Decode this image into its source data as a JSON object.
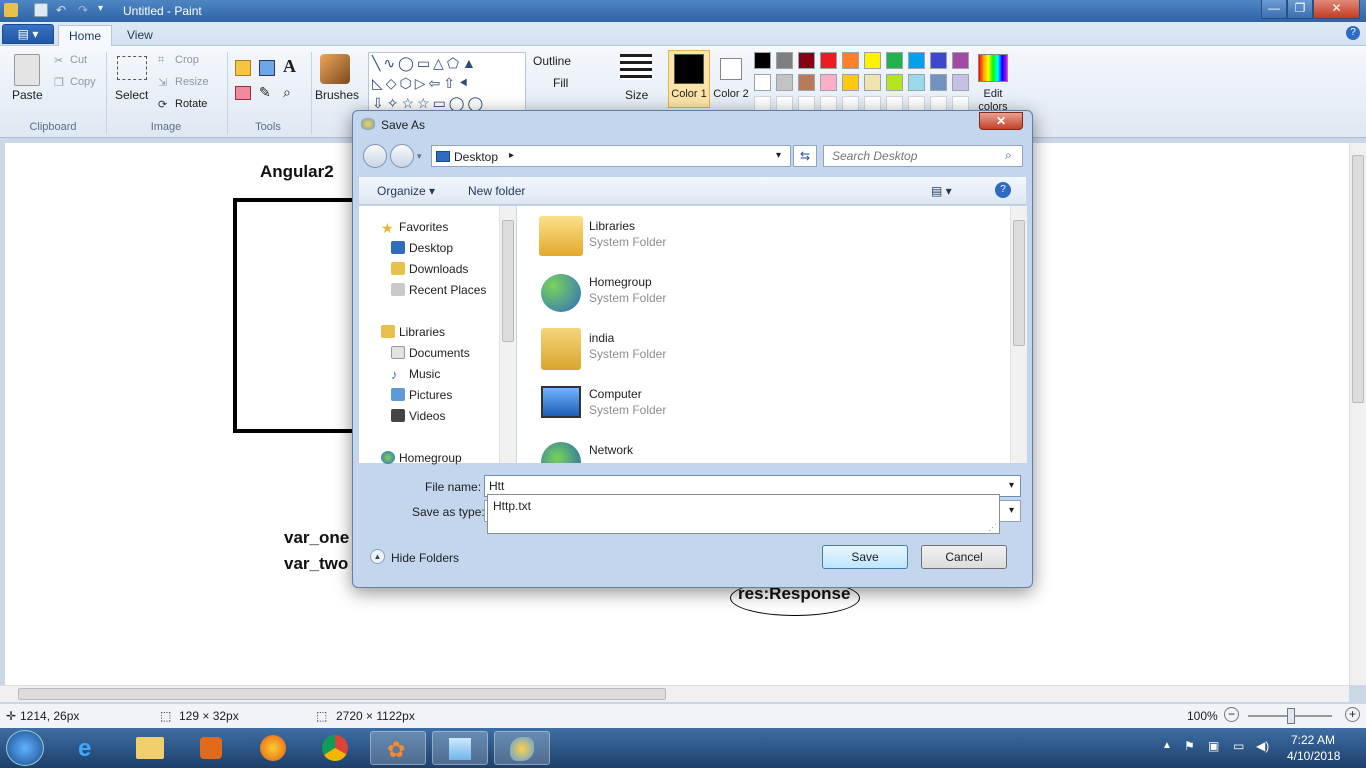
{
  "window": {
    "title": "Untitled - Paint",
    "minimize": "—",
    "maximize": "❐",
    "close": "✕"
  },
  "ribbon": {
    "file_tab": "▤ ▾",
    "tabs": [
      {
        "label": "Home"
      },
      {
        "label": "View"
      }
    ],
    "clipboard": {
      "paste": "Paste",
      "cut": "Cut",
      "copy": "Copy",
      "label": "Clipboard"
    },
    "image": {
      "select": "Select",
      "crop": "Crop",
      "resize": "Resize",
      "rotate": "Rotate",
      "label": "Image"
    },
    "tools": {
      "label": "Tools",
      "text_tool": "A"
    },
    "brushes": "Brushes",
    "shapes": {
      "outline": "Outline",
      "fill": "Fill"
    },
    "size": "Size",
    "color1": "Color 1",
    "color2": "Color 2",
    "edit_colors": "Edit colors",
    "palette_row1": [
      "#000000",
      "#7f7f7f",
      "#880015",
      "#ed1c24",
      "#ff7f27",
      "#fff200",
      "#22b14c",
      "#00a2e8",
      "#3f48cc",
      "#a349a4"
    ],
    "palette_row2": [
      "#ffffff",
      "#c3c3c3",
      "#b97a57",
      "#ffaec9",
      "#ffc90e",
      "#efe4b0",
      "#b5e61d",
      "#99d9ea",
      "#7092be",
      "#c8bfe7"
    ]
  },
  "canvas": {
    "texts": {
      "title": "Angular2",
      "var_one": "var_one",
      "var_two": "var_two",
      "res": "res:Response"
    }
  },
  "dialog": {
    "title": "Save As",
    "address": "Desktop",
    "search_placeholder": "Search Desktop",
    "toolbar": {
      "organize": "Organize ▾",
      "new_folder": "New folder"
    },
    "nav": {
      "favorites": "Favorites",
      "desktop": "Desktop",
      "downloads": "Downloads",
      "recent": "Recent Places",
      "libraries": "Libraries",
      "documents": "Documents",
      "music": "Music",
      "pictures": "Pictures",
      "videos": "Videos",
      "homegroup": "Homegroup"
    },
    "items": [
      {
        "name": "Libraries",
        "type": "System Folder"
      },
      {
        "name": "Homegroup",
        "type": "System Folder"
      },
      {
        "name": "india",
        "type": "System Folder"
      },
      {
        "name": "Computer",
        "type": "System Folder"
      },
      {
        "name": "Network",
        "type": ""
      }
    ],
    "file_name_label": "File name:",
    "file_name_value": "Htt",
    "save_as_type_label": "Save as type:",
    "autocomplete": "Http.txt",
    "hide_folders": "Hide Folders",
    "save": "Save",
    "cancel": "Cancel"
  },
  "status": {
    "cursor": "1214, 26px",
    "selection": "129 × 32px",
    "image_size": "2720 × 1122px",
    "zoom": "100%"
  },
  "taskbar": {
    "time": "7:22 AM",
    "date": "4/10/2018"
  }
}
